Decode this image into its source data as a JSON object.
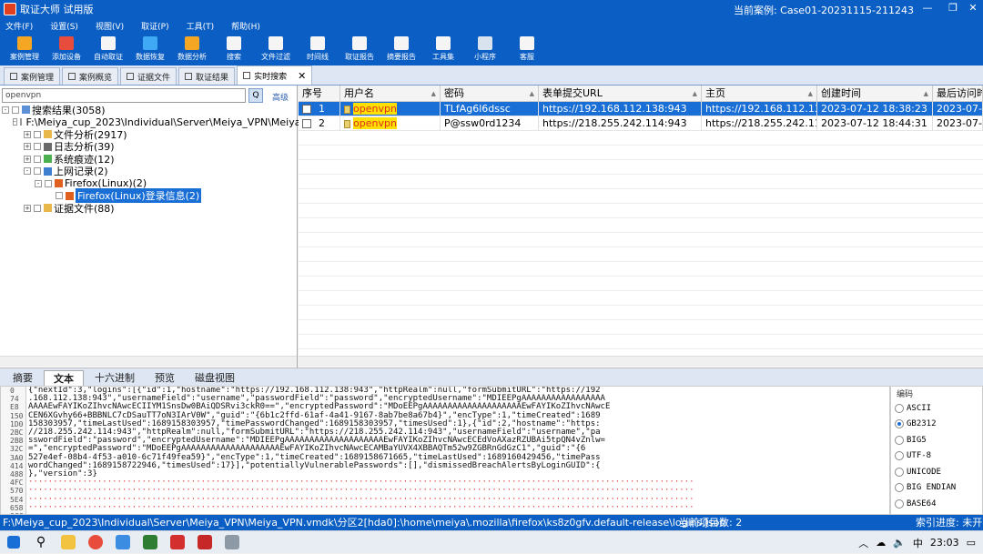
{
  "window": {
    "title": "取证大师 试用版",
    "case_label": "当前案例: Case01-20231115-211243"
  },
  "menu": [
    "文件(F)",
    "设置(S)",
    "视图(V)",
    "取证(P)",
    "工具(T)",
    "帮助(H)"
  ],
  "toolbar": [
    "案例管理",
    "添加设备",
    "自动取证",
    "数据恢复",
    "数据分析",
    "搜索",
    "文件过滤",
    "时间线",
    "取证报告",
    "摘要报告",
    "工具集",
    "小程序",
    "客服"
  ],
  "tabs": [
    "案例管理",
    "案例概览",
    "证据文件",
    "取证结果",
    "实时搜索"
  ],
  "search": {
    "value": "openvpn",
    "button": "Q",
    "advanced": "高级"
  },
  "tree": [
    {
      "label": "搜索结果(3058)",
      "indent": 0,
      "pm": "-"
    },
    {
      "label": "F:\\Meiya_cup_2023\\Individual\\Server\\Meiya_VPN\\Meiya_VI",
      "indent": 1,
      "pm": "-"
    },
    {
      "label": "文件分析(2917)",
      "indent": 2,
      "pm": "+"
    },
    {
      "label": "日志分析(39)",
      "indent": 2,
      "pm": "+"
    },
    {
      "label": "系统痕迹(12)",
      "indent": 2,
      "pm": "+"
    },
    {
      "label": "上网记录(2)",
      "indent": 2,
      "pm": "-"
    },
    {
      "label": "Firefox(Linux)(2)",
      "indent": 3,
      "pm": "-"
    },
    {
      "label": "Firefox(Linux)登录信息(2)",
      "indent": 4,
      "pm": "",
      "selected": true
    },
    {
      "label": "证据文件(88)",
      "indent": 2,
      "pm": "+"
    }
  ],
  "grid": {
    "columns": [
      "序号",
      "用户名",
      "密码",
      "表单提交URL",
      "主页",
      "创建时间",
      "最后访问时"
    ],
    "rows": [
      {
        "no": "1",
        "user": "openvpn",
        "pwd": "TLfAg6l6dssc",
        "url": "https://192.168.112.138:943",
        "home": "https://192.168.112.13...",
        "created": "2023-07-12 18:38:23",
        "last": "2023-07-1",
        "selected": true
      },
      {
        "no": "2",
        "user": "openvpn",
        "pwd": "P@ssw0rd1234",
        "url": "https://218.255.242.114:943",
        "home": "https://218.255.242.11...",
        "created": "2023-07-12 18:44:31",
        "last": "2023-07-1",
        "selected": false
      }
    ]
  },
  "bottom_tabs": [
    "摘要",
    "文本",
    "十六进制",
    "预览",
    "磁盘视图"
  ],
  "text_offsets": [
    "0",
    "74",
    "E8",
    "150",
    "1D0",
    "2BC",
    "2B8",
    "32C",
    "3A0",
    "414",
    "488",
    "4FC",
    "570",
    "5E4",
    "658",
    "6CC",
    "740"
  ],
  "text_lines": [
    "{\"nextId\":3,\"logins\":[{\"id\":1,\"hostname\":\"https://192.168.112.138:943\",\"httpRealm\":null,\"formSubmitURL\":\"https://192",
    ".168.112.138:943\",\"usernameField\":\"username\",\"passwordField\":\"password\",\"encryptedUsername\":\"MDIEEPgAAAAAAAAAAAAAAAAA",
    "AAAAEwFAYIKoZIhvcNAwcECIIYM1SnsDw0BAiQDSRvi3ckR0==\",\"encryptedPassword\":\"MDoEEPgAAAAAAAAAAAAAAAAAAAAEwFAYIKoZIhvcNAwcE",
    "CEN6XGvhy66+BBBNLC7cDSauTT7oN3IArV0W\",\"guid\":\"{6b1c2ffd-61af-4a41-9167-8ab7be8a67b4}\",\"encType\":1,\"timeCreated\":1689",
    "158303957,\"timeLastUsed\":1689158303957,\"timePasswordChanged\":1689158303957,\"timesUsed\":1},{\"id\":2,\"hostname\":\"https:",
    "//218.255.242.114:943\",\"httpRealm\":null,\"formSubmitURL\":\"https://218.255.242.114:943\",\"usernameField\":\"username\",\"pa",
    "sswordField\":\"password\",\"encryptedUsername\":\"MDIEEPgAAAAAAAAAAAAAAAAAAAAEwFAYIKoZIhvcNAwcECEdVoAXazRZUBAi5tpQN4vZnlw=",
    "=\",\"encryptedPassword\":\"MDoEEPgAAAAAAAAAAAAAAAAAAAAEwFAYIKoZIhvcNAwcECAMBaYUVX4XBBAQTm52w9ZGBRnGdGzC1\",\"guid\":\"{6",
    "527e4ef-08b4-4f53-a010-6c71f49fea59}\",\"encType\":1,\"timeCreated\":1689158671665,\"timeLastUsed\":1689160429456,\"timePass",
    "wordChanged\":1689158722946,\"timesUsed\":17}],\"potentiallyVulnerablePasswords\":[],\"dismissedBreachAlertsByLoginGUID\":{",
    "},\"version\":3}"
  ],
  "dots_lines": 6,
  "encodings": {
    "header": "编码",
    "items": [
      "ASCII",
      "GB2312",
      "BIG5",
      "UTF-8",
      "UNICODE",
      "BIG ENDIAN",
      "BASE64"
    ],
    "selected": "GB2312"
  },
  "status": {
    "path": "F:\\Meiya_cup_2023\\Individual\\Server\\Meiya_VPN\\Meiya_VPN.vmdk\\分区2[hda0]:\\home\\meiya\\.mozilla\\firefox\\ks8z0gfv.default-release\\logins.json",
    "count": "当前项目数: 2",
    "progress": "索引进度: 未开始"
  },
  "taskbar": {
    "time": "23:03",
    "lang": "中"
  }
}
